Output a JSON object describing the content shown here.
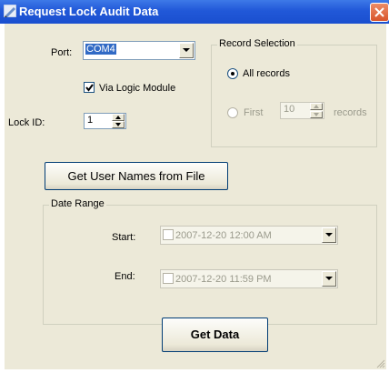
{
  "window": {
    "title": "Request Lock Audit Data"
  },
  "port": {
    "label": "Port:",
    "value": "COM4"
  },
  "via_logic": {
    "label": "Via Logic Module",
    "checked": true
  },
  "lock_id": {
    "label": "Lock ID:",
    "value": "1"
  },
  "record_selection": {
    "title": "Record Selection",
    "all_label": "All records",
    "first_label": "First",
    "first_value": "10",
    "records_label": "records",
    "selected": "all"
  },
  "get_names_button": "Get User Names from File",
  "date_range": {
    "title": "Date Range",
    "start_label": "Start:",
    "start_value": "2007-12-20 12:00 AM",
    "end_label": "End:",
    "end_value": "2007-12-20 11:59 PM"
  },
  "get_data_button": "Get Data"
}
